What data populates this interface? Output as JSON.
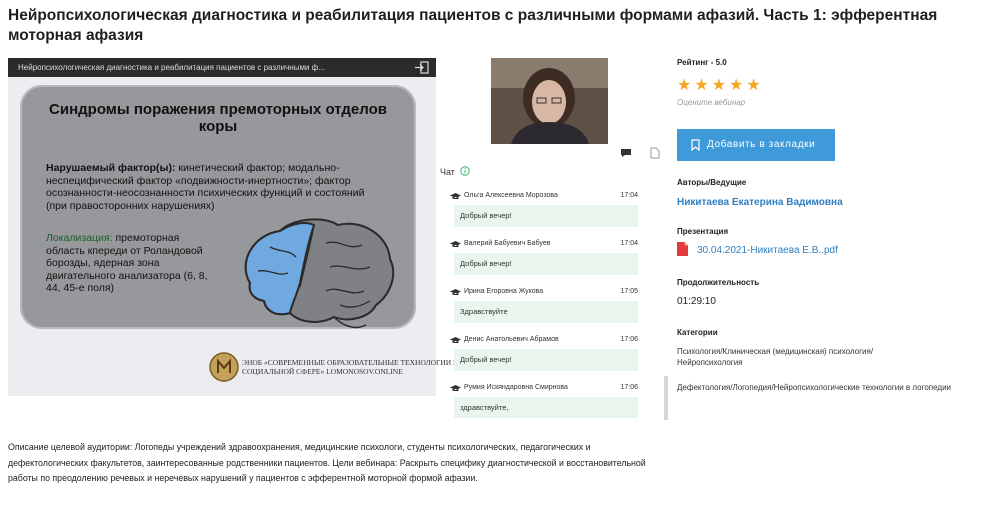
{
  "page": {
    "title": "Нейропсихологическая диагностика и реабилитация пациентов с различными формами афазий. Часть 1: эфферентная моторная афазия"
  },
  "player": {
    "title_truncated": "Нейропсихологическая диагностика и реабилитация пациентов с различными ф...",
    "exit_icon": "exit-icon"
  },
  "slide": {
    "heading": "Синдромы поражения премоторных отделов коры",
    "factor_label": "Нарушаемый фактор(ы):",
    "factor_text": " кинетический фактор; модально-неспецифический фактор «подвижности-инертности»; фактор осознанности-неосознанности психических функций и состояний (при правосторонних нарушениях)",
    "loc_label": "Локализация:",
    "loc_text": " премоторная область кпереди от Роландовой борозды, ядерная зона двигательного анализатора (6, 8, 44, 45-е поля)",
    "footer": "ЭНОБ «СОВРЕМЕННЫЕ ОБРАЗОВАТЕЛЬНЫЕ ТЕХНОЛОГИИ В СОЦИАЛЬНОЙ СФЕРЕ» LOMONOSOV.ONLINE"
  },
  "chat": {
    "label": "Чат",
    "messages": [
      {
        "author": "Ольга Алексеевна Морозова",
        "time": "17:04",
        "text": "Добрый вечер!"
      },
      {
        "author": "Валерий Бабуевич Бабуев",
        "time": "17:04",
        "text": "Добрый вечер!"
      },
      {
        "author": "Ирина Егоровна Жукова",
        "time": "17:05",
        "text": "Здравствуйте"
      },
      {
        "author": "Денис Анатольевич Абрамов",
        "time": "17:06",
        "text": "Добрый вечер!"
      },
      {
        "author": "Румия Искяндаровна Смирнова",
        "time": "17:06",
        "text": "здравствуйте,"
      }
    ]
  },
  "sidebar": {
    "rating_label": "Рейтинг - 5.0",
    "stars": 5,
    "rate_hint": "Оцените вебинар",
    "bookmark_label": "Добавить в закладки",
    "authors_label": "Авторы/Ведущие",
    "author": "Никитаева Екатерина Вадимовна",
    "presentation_label": "Презентация",
    "presentation_file": "30.04.2021-Никитаева Е.В..pdf",
    "duration_label": "Продолжительность",
    "duration": "01:29:10",
    "categories_label": "Категории",
    "categories": [
      "Психология/Клиническая (медицинская) психология/Нейропсихология",
      "Дефектология/Логопедия/Нейропсихологические технологии в логопедии"
    ]
  },
  "description": "Описание целевой аудитории: Логопеды учреждений здравоохранения, медицинские психологи, студенты психологических, педагогических и дефектологических факультетов, заинтересованные родственники пациентов. Цели вебинара: Раскрыть специфику диагностической и восстановительной работы по преодолению речевых и неречевых нарушений у пациентов с эфферентной моторной формой афазии.",
  "colors": {
    "accent": "#3f9ad9",
    "link": "#2f7fc1",
    "star": "#f5a623",
    "chat_bubble": "#e8f6ee"
  }
}
